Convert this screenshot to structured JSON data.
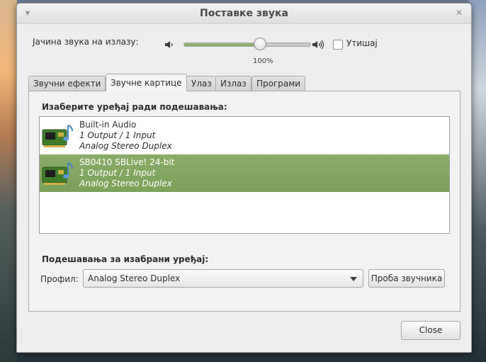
{
  "window": {
    "title": "Поставке звука"
  },
  "output_volume": {
    "label": "Јачина звука на излазу:",
    "level_percent": 100,
    "value_text": "100%",
    "mute_label": "Утишај",
    "muted": false
  },
  "tabs": [
    {
      "label": "Звучни ефекти",
      "active": false
    },
    {
      "label": "Звучне картице",
      "active": true
    },
    {
      "label": "Улаз",
      "active": false
    },
    {
      "label": "Излаз",
      "active": false
    },
    {
      "label": "Програми",
      "active": false
    }
  ],
  "hardware": {
    "select_title": "Изаберите уређај ради подешавања:",
    "devices": [
      {
        "name": "Built-in Audio",
        "io": "1 Output / 1 Input",
        "profile": "Analog Stereo Duplex",
        "selected": false
      },
      {
        "name": "SB0410 SBLive! 24-bit",
        "io": "1 Output / 1 Input",
        "profile": "Analog Stereo Duplex",
        "selected": true
      }
    ],
    "settings_title": "Подешавања за изабрани уређај:",
    "profile_label": "Профил:",
    "profile_value": "Analog Stereo Duplex",
    "test_button": "Проба звучника"
  },
  "footer": {
    "close_label": "Close"
  },
  "colors": {
    "selection": "#7fa45f",
    "accent_green": "#8ab56b"
  },
  "icons": {
    "titlebar_left": "menu-icon",
    "titlebar_right": "close-icon",
    "volume_low": "speaker-low-icon",
    "volume_high": "speaker-high-icon",
    "device": "sound-card-icon"
  }
}
